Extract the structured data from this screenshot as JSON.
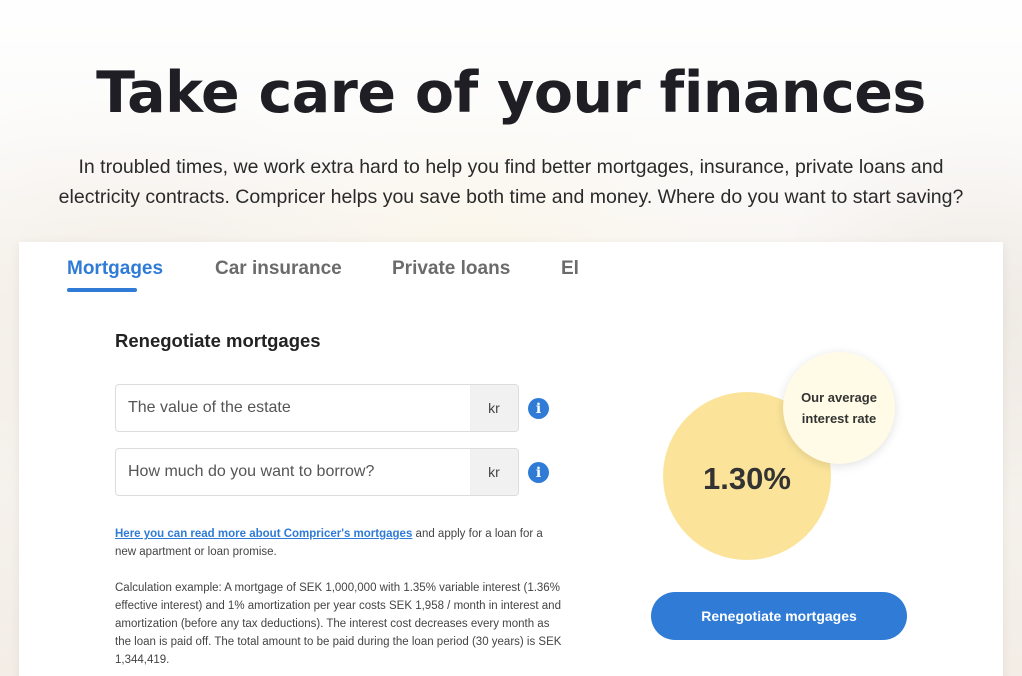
{
  "hero": {
    "title": "Take care of your finances",
    "subtitle_line1": "In troubled times, we work extra hard to help you find better mortgages, insurance, private loans and",
    "subtitle_line2": "electricity contracts. Compricer helps you save both time and money. Where do you want to start saving?"
  },
  "tabs": [
    {
      "label": "Mortgages",
      "active": true
    },
    {
      "label": "Car insurance",
      "active": false
    },
    {
      "label": "Private loans",
      "active": false
    },
    {
      "label": "El",
      "active": false
    }
  ],
  "form": {
    "section_title": "Renegotiate mortgages",
    "estate_value": {
      "placeholder": "The value of the estate",
      "unit": "kr"
    },
    "borrow_amount": {
      "placeholder": "How much do you want to borrow?",
      "unit": "kr"
    },
    "link_label": "Here you can read more about Compricer's mortgages",
    "link_suffix": " and apply for a loan for a new apartment or loan promise.",
    "calculation_example": "Calculation example: A mortgage of SEK 1,000,000 with 1.35% variable interest (1.36% effective interest) and 1% amortization per year costs SEK 1,958 / month in interest and amortization (before any tax deductions). The interest cost decreases every month as the loan is paid off. The total amount to be paid during the loan period (30 years) is SEK 1,344,419."
  },
  "rate": {
    "value": "1.30%",
    "bubble_label": "Our average interest rate"
  },
  "cta": {
    "label": "Renegotiate mortgages"
  },
  "colors": {
    "accent": "#2f7bd6",
    "rate_circle": "#fbe49a",
    "bubble": "#fffbe6"
  },
  "icons": {
    "info": "info-icon"
  }
}
